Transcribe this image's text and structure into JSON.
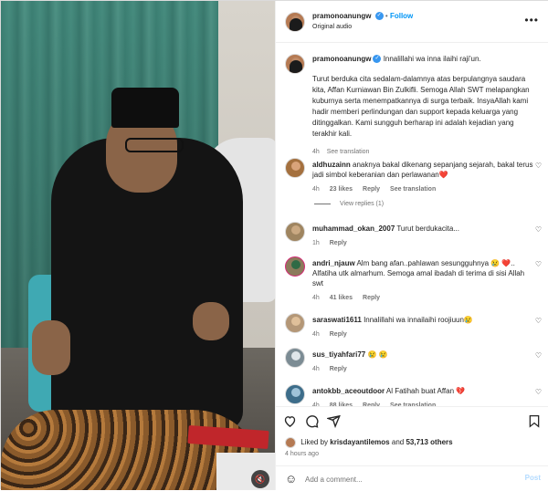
{
  "post": {
    "username": "pramonoanungw",
    "follow_label": "Follow",
    "audio": "Original audio",
    "more_label": "•••"
  },
  "caption": {
    "username": "pramonoanungw",
    "first_line": "Innalillahi wa inna ilaihi raji'un.",
    "body": "Turut berduka cita sedalam-dalamnya atas berpulangnya saudara kita, Affan Kurniawan Bin Zulkifli. Semoga Allah SWT melapangkan kuburnya serta menempatkannya di surga terbaik. InsyaAllah kami hadir memberi perlindungan dan support kepada keluarga yang ditinggalkan. Kami sungguh berharap ini adalah kejadian yang terakhir kali.",
    "time": "4h",
    "see_translation": "See translation"
  },
  "comments": [
    {
      "username": "aldhuzainn",
      "text": "anaknya bakal dikenang sepanjang sejarah, bakal terus jadi simbol keberanian dan perlawanan❤️",
      "time": "4h",
      "likes": "23 likes",
      "reply": "Reply",
      "translation": "See translation"
    },
    {
      "username": "muhammad_okan_2007",
      "text": "Turut berdukacita...",
      "time": "1h",
      "likes": "",
      "reply": "Reply",
      "translation": ""
    },
    {
      "username": "andri_njauw",
      "text": "Alm bang afan..pahlawan sesungguhnya 😢 ❤️.. Alfatiha utk almarhum. Semoga amal ibadah di terima di sisi Allah swt",
      "time": "4h",
      "likes": "41 likes",
      "reply": "Reply",
      "translation": ""
    },
    {
      "username": "saraswati1611",
      "text": "Innalillahi wa innailaihi roojiuun😢",
      "time": "4h",
      "likes": "",
      "reply": "Reply",
      "translation": ""
    },
    {
      "username": "sus_tiyahfari77",
      "text": "😢 😢",
      "time": "4h",
      "likes": "",
      "reply": "Reply",
      "translation": ""
    },
    {
      "username": "antokbb_aceoutdoor",
      "text": "Al Fatihah buat Affan 💔",
      "time": "4h",
      "likes": "88 likes",
      "reply": "Reply",
      "translation": "See translation"
    }
  ],
  "view_replies": "View replies (1)",
  "actions": {
    "like_icon": "heart-icon",
    "comment_icon": "comment-icon",
    "share_icon": "share-icon",
    "save_icon": "bookmark-icon",
    "liked_by_prefix": "Liked by",
    "liked_by_user": "krisdayantilemos",
    "liked_by_mid": "and",
    "liked_by_count": "53,713 others",
    "time_ago": "4 hours ago"
  },
  "add_comment": {
    "placeholder": "Add a comment...",
    "post_label": "Post"
  }
}
